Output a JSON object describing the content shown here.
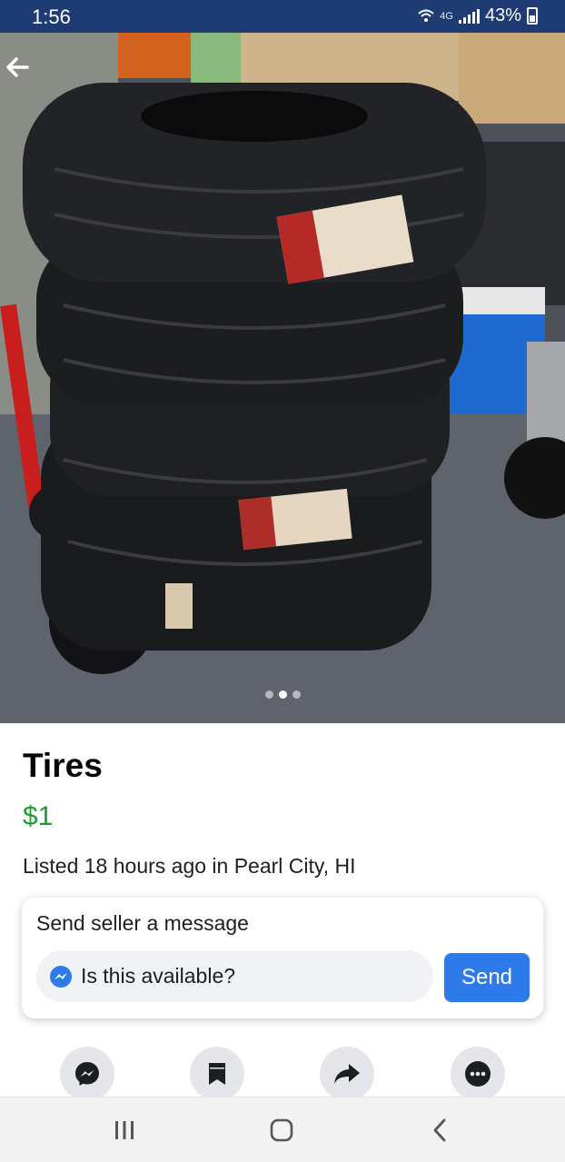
{
  "status_bar": {
    "time": "1:56",
    "network": "4G",
    "battery": "43%"
  },
  "photo": {
    "slide_count": 3,
    "active_slide": 2
  },
  "listing": {
    "title": "Tires",
    "price": "$1",
    "listed_text": "Listed 18 hours ago in Pearl City, HI"
  },
  "message_card": {
    "title": "Send seller a message",
    "input_value": "Is this available?",
    "send_label": "Send"
  },
  "actions": [
    "messenger-icon",
    "bookmark-icon",
    "share-icon",
    "more-icon"
  ],
  "colors": {
    "status_bar": "#1f3b73",
    "price": "#1a9e2c",
    "send_button": "#2d7bea"
  }
}
